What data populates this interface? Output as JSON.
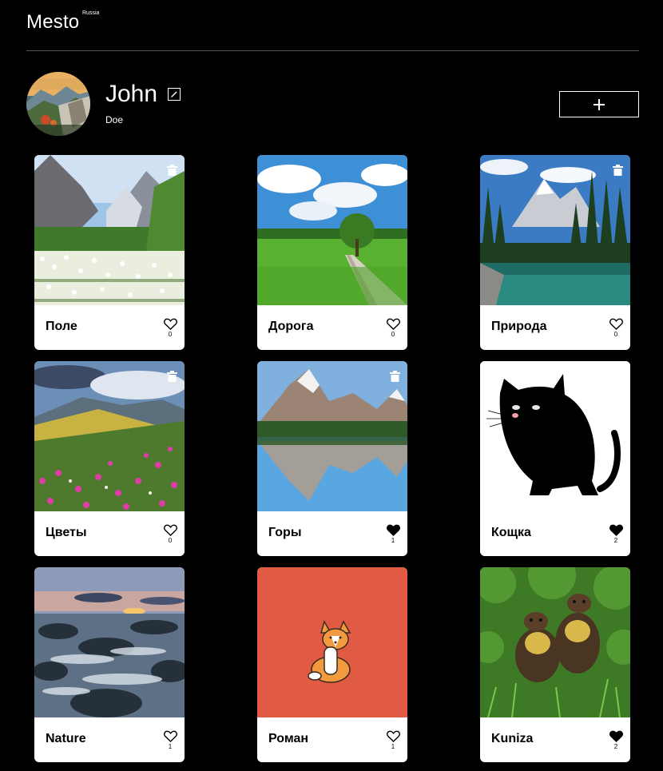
{
  "header": {
    "logo": "Mesto",
    "logo_sup": "Russia"
  },
  "profile": {
    "name": "John",
    "about": "Doe"
  },
  "cards": [
    {
      "title": "Поле",
      "likes": "0",
      "liked": false,
      "deletable": true,
      "image": "meadow-photo"
    },
    {
      "title": "Дорога",
      "likes": "0",
      "liked": false,
      "deletable": true,
      "image": "road-photo"
    },
    {
      "title": "Природа",
      "likes": "0",
      "liked": false,
      "deletable": true,
      "image": "forest-lake-photo"
    },
    {
      "title": "Цветы",
      "likes": "0",
      "liked": false,
      "deletable": true,
      "image": "flowers-photo"
    },
    {
      "title": "Горы",
      "likes": "1",
      "liked": true,
      "deletable": true,
      "image": "mountains-photo"
    },
    {
      "title": "Кощка",
      "likes": "2",
      "liked": true,
      "deletable": false,
      "image": "black-cat-drawing"
    },
    {
      "title": "Nature",
      "likes": "1",
      "liked": false,
      "deletable": false,
      "image": "sea-rocks-photo"
    },
    {
      "title": "Роман",
      "likes": "1",
      "liked": false,
      "deletable": false,
      "image": "corgi-drawing"
    },
    {
      "title": "Kuniza",
      "likes": "2",
      "liked": true,
      "deletable": false,
      "image": "martens-photo"
    }
  ],
  "colors": {
    "background": "#000000",
    "card": "#ffffff",
    "divider": "#545454",
    "corgi_bg": "#e05a44"
  }
}
